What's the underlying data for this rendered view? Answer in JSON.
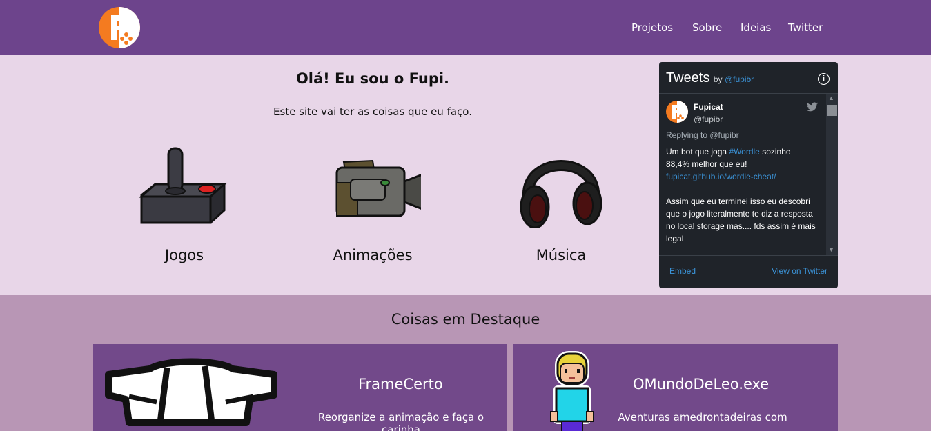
{
  "header": {
    "nav": [
      "Projetos",
      "Sobre",
      "Ideias",
      "Twitter"
    ],
    "colors": {
      "bar": "#6d448c",
      "logo_orange": "#f47b20"
    }
  },
  "hero": {
    "title": "Olá! Eu sou o Fupi.",
    "subtitle": "Este site vai ter as coisas que eu faço.",
    "categories": [
      {
        "label": "Jogos",
        "icon": "joystick-icon"
      },
      {
        "label": "Animações",
        "icon": "camera-icon"
      },
      {
        "label": "Música",
        "icon": "headphones-icon"
      }
    ]
  },
  "twitter": {
    "heading": "Tweets",
    "by": "by",
    "account": "@fupibr",
    "tweet": {
      "name": "Fupicat",
      "handle": "@fupibr",
      "replying": "Replying to @fupibr",
      "line1_a": "Um bot que joga ",
      "hashtag": "#Wordle",
      "line1_b": " sozinho",
      "line2": "88,4% melhor que eu!",
      "link": "fupicat.github.io/wordle-cheat/",
      "para2": "Assim que eu terminei isso eu descobri que o jogo literalmente te diz a resposta no local storage mas.... fds assim é mais legal"
    },
    "embed": "Embed",
    "view": "View on Twitter"
  },
  "featured": {
    "title": "Coisas em Destaque",
    "cards": [
      {
        "title": "FrameCerto",
        "desc": "Reorganize a animação e faça o carinha"
      },
      {
        "title": "OMundoDeLeo.exe",
        "desc": "Aventuras amedrontadeiras com"
      }
    ]
  }
}
